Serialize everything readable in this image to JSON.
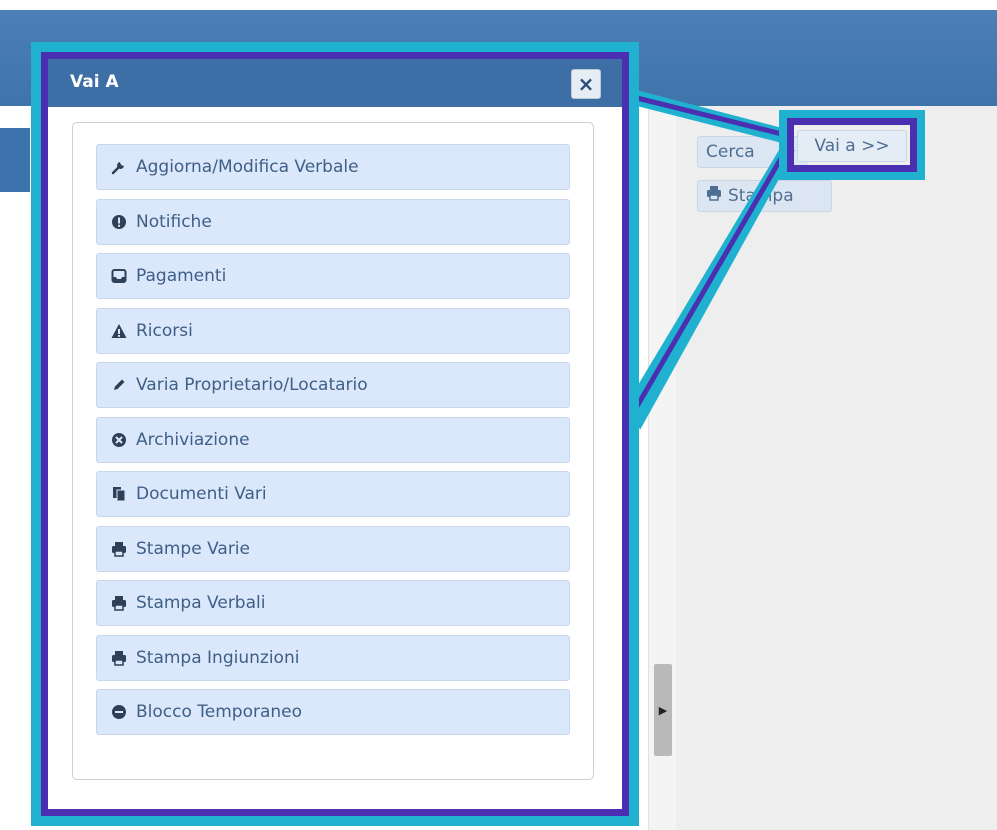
{
  "dialog": {
    "title": "Vai A",
    "close_label": "×"
  },
  "menu": {
    "items": [
      {
        "label": "Aggiorna/Modifica Verbale",
        "icon": "wrench-icon"
      },
      {
        "label": "Notifiche",
        "icon": "exclamation-circle-icon"
      },
      {
        "label": "Pagamenti",
        "icon": "inbox-icon"
      },
      {
        "label": "Ricorsi",
        "icon": "warning-icon"
      },
      {
        "label": "Varia Proprietario/Locatario",
        "icon": "pencil-icon"
      },
      {
        "label": "Archiviazione",
        "icon": "times-circle-icon"
      },
      {
        "label": "Documenti Vari",
        "icon": "documents-icon"
      },
      {
        "label": "Stampe Varie",
        "icon": "print-icon"
      },
      {
        "label": "Stampa Verbali",
        "icon": "print-icon"
      },
      {
        "label": "Stampa Ingiunzioni",
        "icon": "print-icon"
      },
      {
        "label": "Blocco Temporaneo",
        "icon": "minus-circle-icon"
      }
    ]
  },
  "side": {
    "cerca_label": "Cerca",
    "vaia_label": "Vai a >>",
    "stampa_label": "Stampa"
  },
  "colors": {
    "header": "#3d6fa6",
    "highlight_outer": "#20b0d0",
    "highlight_inner": "#4a2fb0",
    "menu_item_bg": "#dbe7fb"
  }
}
